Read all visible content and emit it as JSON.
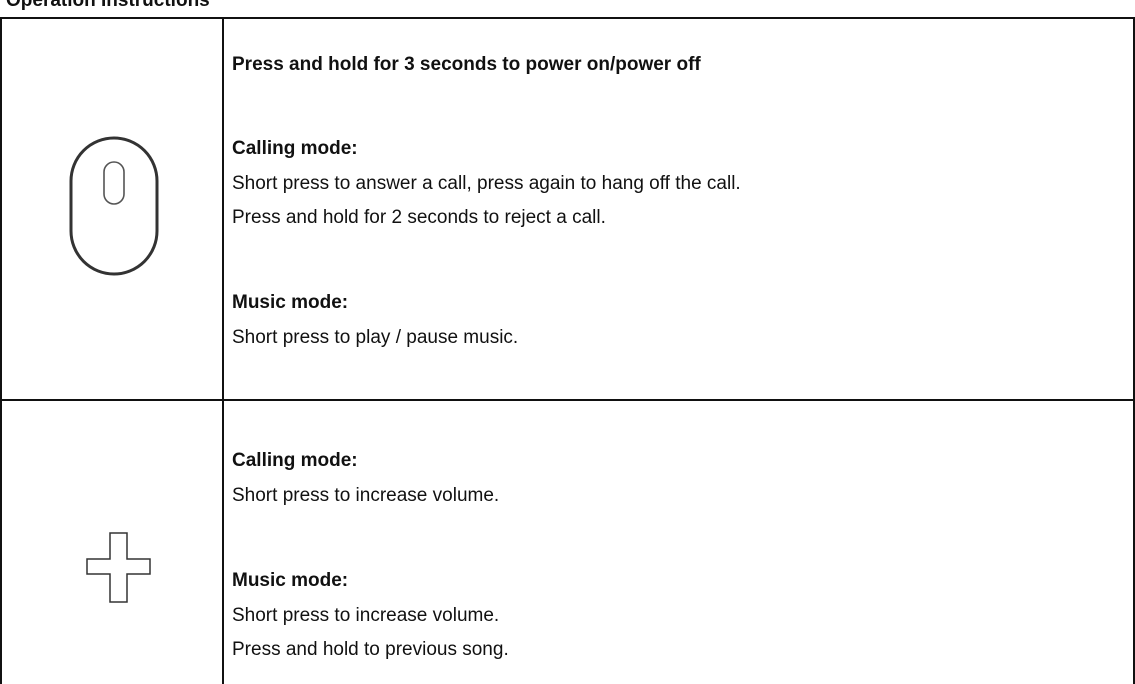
{
  "heading_fragment": "Operation Instructions",
  "rows": [
    {
      "icon": "power-button-icon",
      "lines": [
        {
          "text": "Press and hold for 3 seconds to power on/power off",
          "bold": true
        },
        {
          "text": "Calling mode:",
          "bold": true
        },
        {
          "text": "Short press to answer a call, press again to hang off the call.",
          "bold": false
        },
        {
          "text": "Press and hold for 2 seconds to reject a call.",
          "bold": false
        },
        {
          "text": "Music mode:",
          "bold": true
        },
        {
          "text": "Short press to play / pause music.",
          "bold": false
        }
      ]
    },
    {
      "icon": "plus-button-icon",
      "lines": [
        {
          "text": "Calling mode:",
          "bold": true
        },
        {
          "text": "Short press to increase volume.",
          "bold": false
        },
        {
          "text": "Music mode:",
          "bold": true
        },
        {
          "text": "Short press to increase volume.",
          "bold": false
        },
        {
          "text": "Press and hold to previous song.",
          "bold": false
        }
      ]
    }
  ]
}
